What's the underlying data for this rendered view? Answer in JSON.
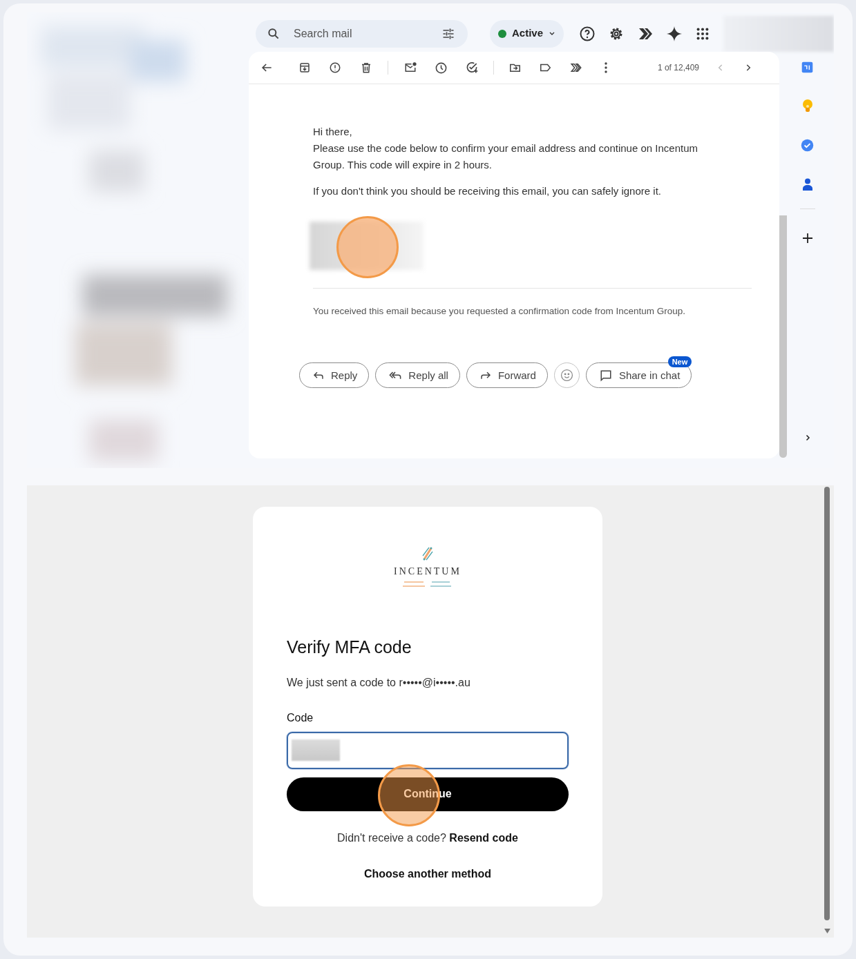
{
  "search": {
    "placeholder": "Search mail"
  },
  "status": {
    "label": "Active"
  },
  "toolbar": {
    "count": "1 of 12,409"
  },
  "email": {
    "greeting": "Hi there,",
    "paragraphs": [
      "Please use the code below to confirm your email address and continue on Incentum Group. This code will expire in 2 hours.",
      "If you don't think you should be receiving this email, you can safely ignore it."
    ],
    "footer": "You received this email because you requested a confirmation code from Incentum Group."
  },
  "actions": [
    {
      "kind": "reply",
      "label": "Reply"
    },
    {
      "kind": "reply_all",
      "label": "Reply all"
    },
    {
      "kind": "forward",
      "label": "Forward"
    },
    {
      "kind": "emoji"
    },
    {
      "kind": "chat",
      "label": "Share in chat",
      "badge": "New"
    }
  ],
  "mfa": {
    "logo_text": "INCENTUM",
    "title": "Verify MFA code",
    "message": "We just sent a code to r•••••@i•••••.au",
    "code_label": "Code",
    "button": "Continue",
    "resend_prompt": "Didn't receive a code?",
    "resend_link": "Resend code",
    "other_method": "Choose another method"
  }
}
